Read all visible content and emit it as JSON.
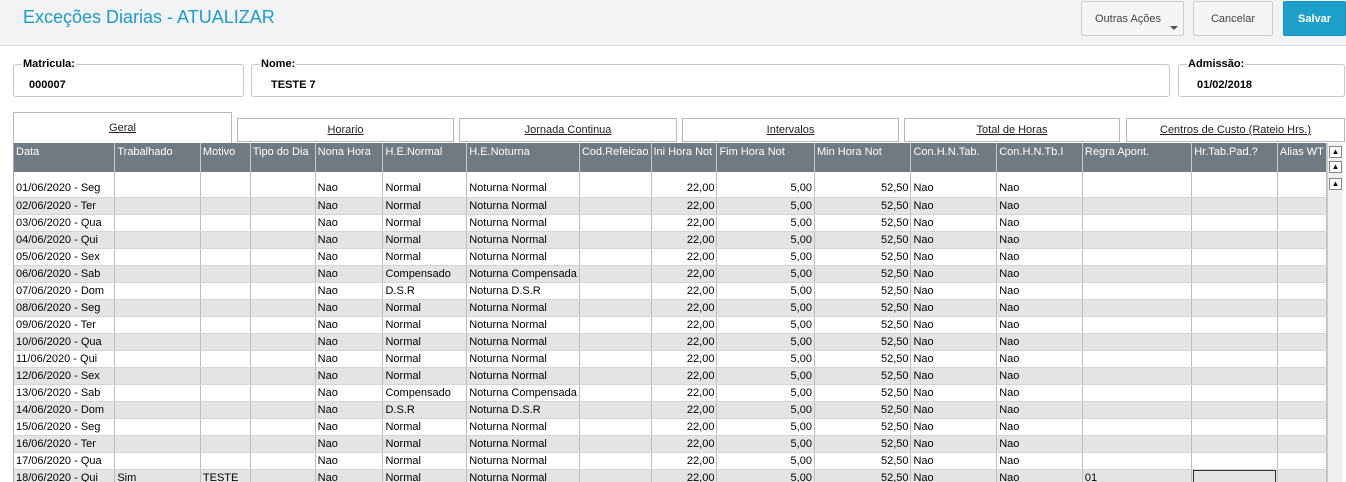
{
  "header": {
    "title": "Exceções Diarias - ATUALIZAR",
    "buttons": {
      "more": "Outras Ações",
      "cancel": "Cancelar",
      "save": "Salvar"
    }
  },
  "fields": {
    "matricula": {
      "label": "Matricula:",
      "value": "000007"
    },
    "nome": {
      "label": "Nome:",
      "value": "TESTE 7"
    },
    "admissao": {
      "label": "Admissão:",
      "value": "01/02/2018"
    }
  },
  "tabs": [
    "Geral",
    "Horario",
    "Jornada Continua",
    "Intervalos",
    "Total de Horas",
    "Centros de Custo (Rateio Hrs.)"
  ],
  "active_tab": "Geral",
  "grid": {
    "columns": [
      "Data",
      "Trabalhado",
      "Motivo",
      "Tipo do Dia",
      "Nona Hora",
      "H.E.Normal",
      "H.E.Noturna",
      "Cod.Refeicao",
      "Ini Hora Not",
      "Fim Hora Not",
      "Min Hora Not",
      "Con.H.N.Tab.",
      "Con.H.N.Tb.I",
      "Regra Apont.",
      "Hr.Tab.Pad.?",
      "Alias WT"
    ],
    "rows": [
      [
        "01/06/2020 - Seg",
        "",
        "",
        "",
        "Nao",
        "Normal",
        "Noturna Normal",
        "",
        "22,00",
        "5,00",
        "52,50",
        "Nao",
        "Nao",
        "",
        "",
        ""
      ],
      [
        "02/06/2020 - Ter",
        "",
        "",
        "",
        "Nao",
        "Normal",
        "Noturna Normal",
        "",
        "22,00",
        "5,00",
        "52,50",
        "Nao",
        "Nao",
        "",
        "",
        ""
      ],
      [
        "03/06/2020 - Qua",
        "",
        "",
        "",
        "Nao",
        "Normal",
        "Noturna Normal",
        "",
        "22,00",
        "5,00",
        "52,50",
        "Nao",
        "Nao",
        "",
        "",
        ""
      ],
      [
        "04/06/2020 - Qui",
        "",
        "",
        "",
        "Nao",
        "Normal",
        "Noturna Normal",
        "",
        "22,00",
        "5,00",
        "52,50",
        "Nao",
        "Nao",
        "",
        "",
        ""
      ],
      [
        "05/06/2020 - Sex",
        "",
        "",
        "",
        "Nao",
        "Normal",
        "Noturna Normal",
        "",
        "22,00",
        "5,00",
        "52,50",
        "Nao",
        "Nao",
        "",
        "",
        ""
      ],
      [
        "06/06/2020 - Sab",
        "",
        "",
        "",
        "Nao",
        "Compensado",
        "Noturna Compensada",
        "",
        "22,00",
        "5,00",
        "52,50",
        "Nao",
        "Nao",
        "",
        "",
        ""
      ],
      [
        "07/06/2020 - Dom",
        "",
        "",
        "",
        "Nao",
        "D.S.R",
        "Noturna D.S.R",
        "",
        "22,00",
        "5,00",
        "52,50",
        "Nao",
        "Nao",
        "",
        "",
        ""
      ],
      [
        "08/06/2020 - Seg",
        "",
        "",
        "",
        "Nao",
        "Normal",
        "Noturna Normal",
        "",
        "22,00",
        "5,00",
        "52,50",
        "Nao",
        "Nao",
        "",
        "",
        ""
      ],
      [
        "09/06/2020 - Ter",
        "",
        "",
        "",
        "Nao",
        "Normal",
        "Noturna Normal",
        "",
        "22,00",
        "5,00",
        "52,50",
        "Nao",
        "Nao",
        "",
        "",
        ""
      ],
      [
        "10/06/2020 - Qua",
        "",
        "",
        "",
        "Nao",
        "Normal",
        "Noturna Normal",
        "",
        "22,00",
        "5,00",
        "52,50",
        "Nao",
        "Nao",
        "",
        "",
        ""
      ],
      [
        "11/06/2020 - Qui",
        "",
        "",
        "",
        "Nao",
        "Normal",
        "Noturna Normal",
        "",
        "22,00",
        "5,00",
        "52,50",
        "Nao",
        "Nao",
        "",
        "",
        ""
      ],
      [
        "12/06/2020 - Sex",
        "",
        "",
        "",
        "Nao",
        "Normal",
        "Noturna Normal",
        "",
        "22,00",
        "5,00",
        "52,50",
        "Nao",
        "Nao",
        "",
        "",
        ""
      ],
      [
        "13/06/2020 - Sab",
        "",
        "",
        "",
        "Nao",
        "Compensado",
        "Noturna Compensada",
        "",
        "22,00",
        "5,00",
        "52,50",
        "Nao",
        "Nao",
        "",
        "",
        ""
      ],
      [
        "14/06/2020 - Dom",
        "",
        "",
        "",
        "Nao",
        "D.S.R",
        "Noturna D.S.R",
        "",
        "22,00",
        "5,00",
        "52,50",
        "Nao",
        "Nao",
        "",
        "",
        ""
      ],
      [
        "15/06/2020 - Seg",
        "",
        "",
        "",
        "Nao",
        "Normal",
        "Noturna Normal",
        "",
        "22,00",
        "5,00",
        "52,50",
        "Nao",
        "Nao",
        "",
        "",
        ""
      ],
      [
        "16/06/2020 - Ter",
        "",
        "",
        "",
        "Nao",
        "Normal",
        "Noturna Normal",
        "",
        "22,00",
        "5,00",
        "52,50",
        "Nao",
        "Nao",
        "",
        "",
        ""
      ],
      [
        "17/06/2020 - Qua",
        "",
        "",
        "",
        "Nao",
        "Normal",
        "Noturna Normal",
        "",
        "22,00",
        "5,00",
        "52,50",
        "Nao",
        "Nao",
        "",
        "",
        ""
      ],
      [
        "18/06/2020 - Qui",
        "Sim",
        "TESTE",
        "",
        "Nao",
        "Normal",
        "Noturna Normal",
        "",
        "22,00",
        "5,00",
        "52,50",
        "Nao",
        "Nao",
        "01",
        "",
        ""
      ]
    ],
    "selected_cell": {
      "row": 17,
      "col": 14
    }
  },
  "scrollbar_icons": [
    "scroll-top-icon",
    "page-up-icon",
    "line-up-icon"
  ]
}
